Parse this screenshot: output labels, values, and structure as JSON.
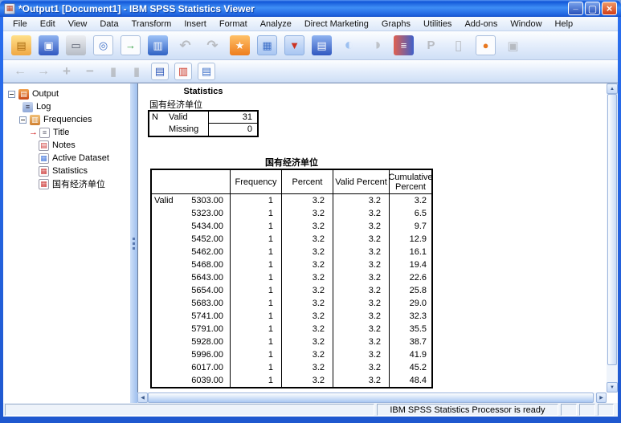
{
  "window": {
    "title": "*Output1 [Document1] - IBM SPSS Statistics Viewer"
  },
  "menubar": {
    "items": [
      "File",
      "Edit",
      "View",
      "Data",
      "Transform",
      "Insert",
      "Format",
      "Analyze",
      "Direct Marketing",
      "Graphs",
      "Utilities",
      "Add-ons",
      "Window",
      "Help"
    ]
  },
  "toolbar_main": {
    "icons": [
      {
        "name": "open-file-icon",
        "disabled": "false"
      },
      {
        "name": "save-icon",
        "disabled": "false"
      },
      {
        "name": "print-icon",
        "disabled": "false"
      },
      {
        "name": "print-preview-icon",
        "disabled": "false"
      },
      {
        "name": "export-icon",
        "disabled": "false"
      },
      {
        "name": "recall-dialogs-icon",
        "disabled": "false"
      },
      {
        "name": "undo-icon",
        "disabled": "true"
      },
      {
        "name": "redo-icon",
        "disabled": "true"
      },
      {
        "name": "goto-data-icon",
        "disabled": "false"
      },
      {
        "name": "goto-case-icon",
        "disabled": "false"
      },
      {
        "name": "goto-variable-icon",
        "disabled": "false"
      },
      {
        "name": "variables-icon",
        "disabled": "false"
      },
      {
        "name": "select-cases-icon",
        "disabled": "false"
      },
      {
        "name": "weight-cases-icon",
        "disabled": "true"
      },
      {
        "name": "split-file-icon",
        "disabled": "false"
      },
      {
        "name": "pivot-icon",
        "disabled": "true"
      },
      {
        "name": "edit-output-icon",
        "disabled": "true"
      },
      {
        "name": "export-browser-icon",
        "disabled": "false"
      },
      {
        "name": "designate-window-icon",
        "disabled": "true"
      }
    ]
  },
  "toolbar_outline": {
    "icons": [
      {
        "name": "promote-icon",
        "disabled": "true"
      },
      {
        "name": "demote-icon",
        "disabled": "true"
      },
      {
        "name": "expand-icon",
        "disabled": "true"
      },
      {
        "name": "collapse-icon",
        "disabled": "true"
      },
      {
        "name": "show-icon",
        "disabled": "true"
      },
      {
        "name": "hide-icon",
        "disabled": "true"
      },
      {
        "name": "show-hide-output-icon",
        "disabled": "false"
      },
      {
        "name": "insert-heading-icon",
        "disabled": "false"
      },
      {
        "name": "insert-text-icon",
        "disabled": "false"
      }
    ]
  },
  "outline": {
    "items": [
      {
        "label": "Output",
        "level": 0,
        "icon": "output-book-icon",
        "expanded": true
      },
      {
        "label": "Log",
        "level": 1,
        "icon": "log-icon"
      },
      {
        "label": "Frequencies",
        "level": 1,
        "icon": "frequencies-icon",
        "expanded": true
      },
      {
        "label": "Title",
        "level": 2,
        "icon": "title-doc-icon",
        "selected": true
      },
      {
        "label": "Notes",
        "level": 2,
        "icon": "notes-icon"
      },
      {
        "label": "Active Dataset",
        "level": 2,
        "icon": "active-dataset-icon"
      },
      {
        "label": "Statistics",
        "level": 2,
        "icon": "statistics-doc-icon"
      },
      {
        "label": "国有经济单位",
        "level": 2,
        "icon": "pivot-table-icon"
      }
    ]
  },
  "content": {
    "statistics_block": {
      "title": "Statistics",
      "variable": "国有经济单位",
      "row_group": "N",
      "rows": [
        {
          "label": "Valid",
          "value": "31"
        },
        {
          "label": "Missing",
          "value": "0"
        }
      ]
    },
    "frequency_table": {
      "title": "国有经济单位",
      "headers": [
        "Frequency",
        "Percent",
        "Valid Percent",
        "Cumulative Percent"
      ],
      "rows": [
        {
          "label": "Valid",
          "value": "5303.00",
          "frequency": "1",
          "percent": "3.2",
          "valid_percent": "3.2",
          "cumulative_percent": "3.2"
        },
        {
          "label": "",
          "value": "5323.00",
          "frequency": "1",
          "percent": "3.2",
          "valid_percent": "3.2",
          "cumulative_percent": "6.5"
        },
        {
          "label": "",
          "value": "5434.00",
          "frequency": "1",
          "percent": "3.2",
          "valid_percent": "3.2",
          "cumulative_percent": "9.7"
        },
        {
          "label": "",
          "value": "5452.00",
          "frequency": "1",
          "percent": "3.2",
          "valid_percent": "3.2",
          "cumulative_percent": "12.9"
        },
        {
          "label": "",
          "value": "5462.00",
          "frequency": "1",
          "percent": "3.2",
          "valid_percent": "3.2",
          "cumulative_percent": "16.1"
        },
        {
          "label": "",
          "value": "5468.00",
          "frequency": "1",
          "percent": "3.2",
          "valid_percent": "3.2",
          "cumulative_percent": "19.4"
        },
        {
          "label": "",
          "value": "5643.00",
          "frequency": "1",
          "percent": "3.2",
          "valid_percent": "3.2",
          "cumulative_percent": "22.6"
        },
        {
          "label": "",
          "value": "5654.00",
          "frequency": "1",
          "percent": "3.2",
          "valid_percent": "3.2",
          "cumulative_percent": "25.8"
        },
        {
          "label": "",
          "value": "5683.00",
          "frequency": "1",
          "percent": "3.2",
          "valid_percent": "3.2",
          "cumulative_percent": "29.0"
        },
        {
          "label": "",
          "value": "5741.00",
          "frequency": "1",
          "percent": "3.2",
          "valid_percent": "3.2",
          "cumulative_percent": "32.3"
        },
        {
          "label": "",
          "value": "5791.00",
          "frequency": "1",
          "percent": "3.2",
          "valid_percent": "3.2",
          "cumulative_percent": "35.5"
        },
        {
          "label": "",
          "value": "5928.00",
          "frequency": "1",
          "percent": "3.2",
          "valid_percent": "3.2",
          "cumulative_percent": "38.7"
        },
        {
          "label": "",
          "value": "5996.00",
          "frequency": "1",
          "percent": "3.2",
          "valid_percent": "3.2",
          "cumulative_percent": "41.9"
        },
        {
          "label": "",
          "value": "6017.00",
          "frequency": "1",
          "percent": "3.2",
          "valid_percent": "3.2",
          "cumulative_percent": "45.2"
        },
        {
          "label": "",
          "value": "6039.00",
          "frequency": "1",
          "percent": "3.2",
          "valid_percent": "3.2",
          "cumulative_percent": "48.4"
        }
      ]
    }
  },
  "statusbar": {
    "message": "IBM SPSS Statistics Processor is ready"
  },
  "colors": {
    "titlebar_blue": "#1e63e0",
    "close_red": "#d23c18",
    "toolbar_bg": "#dfeafa",
    "table_border": "#000000"
  }
}
